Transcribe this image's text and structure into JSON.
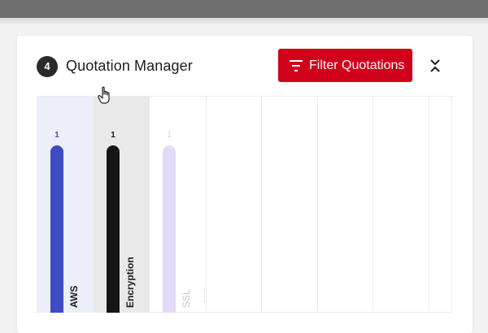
{
  "header": {
    "step_number": "4",
    "title": "Quotation Manager",
    "filter_button_label": "Filter Quotations",
    "accent_color": "#d0021b"
  },
  "chart_data": {
    "type": "bar",
    "categories": [
      "AWS",
      "Encryption",
      "SSL"
    ],
    "values": [
      1,
      1,
      1
    ],
    "value_labels": [
      "1",
      "1",
      "1"
    ],
    "series_colors": [
      "#3d4cc0",
      "#161616",
      "#e2daf6"
    ],
    "highlighted": [
      "AWS",
      "Encryption"
    ],
    "dimmed": [
      "SSL"
    ]
  },
  "icons": {
    "filter": "filter-icon",
    "collapse": "collapse-icon",
    "cursor": "hand-pointer-icon"
  }
}
